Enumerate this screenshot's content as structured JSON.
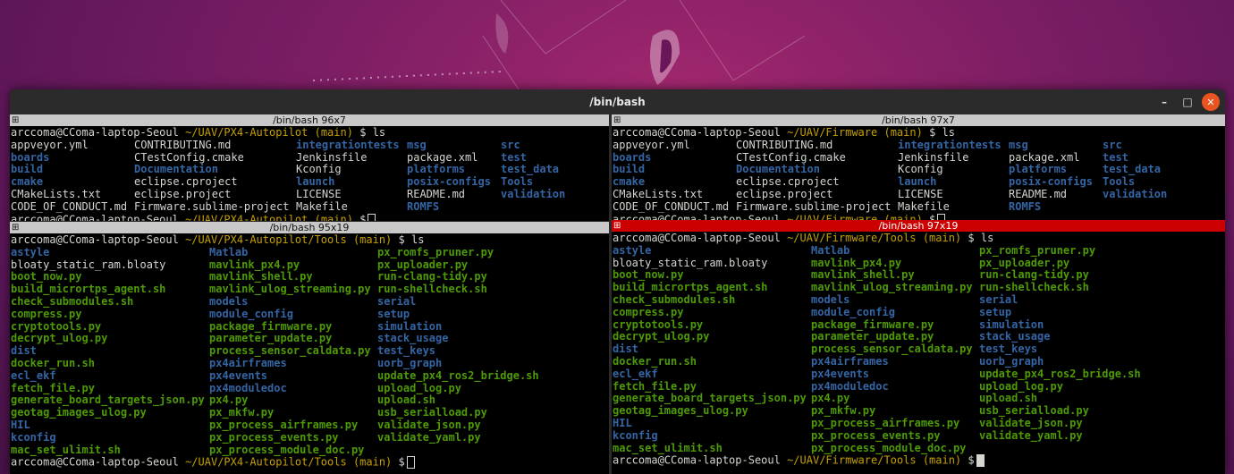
{
  "window": {
    "title": "/bin/bash",
    "controls": {
      "minimize": "–",
      "maximize": "□",
      "close": "✕"
    }
  },
  "colors": {
    "dir": "#3465a4",
    "exec": "#4e9a06",
    "file": "#d3d7cf",
    "branch": "#c4a000",
    "active_title": "#cc0000"
  },
  "icons": {
    "pane": "split-pane-icon"
  },
  "panes": [
    {
      "title": "/bin/bash 96x7",
      "active": false,
      "prompt_user": "arccoma@CComa-laptop-Seoul",
      "prompt_path": "~/UAV/PX4-Autopilot",
      "prompt_branch": "(main)",
      "command": "$ ls",
      "columns": [
        [
          {
            "t": "appveyor.yml",
            "k": "f"
          },
          {
            "t": "boards",
            "k": "d"
          },
          {
            "t": "build",
            "k": "d"
          },
          {
            "t": "cmake",
            "k": "d"
          },
          {
            "t": "CMakeLists.txt",
            "k": "f"
          },
          {
            "t": "CODE_OF_CONDUCT.md",
            "k": "f"
          }
        ],
        [
          {
            "t": "CONTRIBUTING.md",
            "k": "f"
          },
          {
            "t": "CTestConfig.cmake",
            "k": "f"
          },
          {
            "t": "Documentation",
            "k": "d"
          },
          {
            "t": "eclipse.cproject",
            "k": "f"
          },
          {
            "t": "eclipse.project",
            "k": "f"
          },
          {
            "t": "Firmware.sublime-project",
            "k": "f"
          }
        ],
        [
          {
            "t": "integrationtests",
            "k": "d"
          },
          {
            "t": "Jenkinsfile",
            "k": "f"
          },
          {
            "t": "Kconfig",
            "k": "f"
          },
          {
            "t": "launch",
            "k": "d"
          },
          {
            "t": "LICENSE",
            "k": "f"
          },
          {
            "t": "Makefile",
            "k": "f"
          }
        ],
        [
          {
            "t": "msg",
            "k": "d"
          },
          {
            "t": "package.xml",
            "k": "f"
          },
          {
            "t": "platforms",
            "k": "d"
          },
          {
            "t": "posix-configs",
            "k": "d"
          },
          {
            "t": "README.md",
            "k": "f"
          },
          {
            "t": "ROMFS",
            "k": "d"
          }
        ],
        [
          {
            "t": "src",
            "k": "d"
          },
          {
            "t": "test",
            "k": "d"
          },
          {
            "t": "test_data",
            "k": "d"
          },
          {
            "t": "Tools",
            "k": "d"
          },
          {
            "t": "validation",
            "k": "d"
          }
        ]
      ],
      "trailing_prompt": true
    },
    {
      "title": "/bin/bash 97x7",
      "active": false,
      "prompt_user": "arccoma@CComa-laptop-Seoul",
      "prompt_path": "~/UAV/Firmware",
      "prompt_branch": "(main)",
      "command": "$ ls",
      "columns": [
        [
          {
            "t": "appveyor.yml",
            "k": "f"
          },
          {
            "t": "boards",
            "k": "d"
          },
          {
            "t": "build",
            "k": "d"
          },
          {
            "t": "cmake",
            "k": "d"
          },
          {
            "t": "CMakeLists.txt",
            "k": "f"
          },
          {
            "t": "CODE_OF_CONDUCT.md",
            "k": "f"
          }
        ],
        [
          {
            "t": "CONTRIBUTING.md",
            "k": "f"
          },
          {
            "t": "CTestConfig.cmake",
            "k": "f"
          },
          {
            "t": "Documentation",
            "k": "d"
          },
          {
            "t": "eclipse.cproject",
            "k": "f"
          },
          {
            "t": "eclipse.project",
            "k": "f"
          },
          {
            "t": "Firmware.sublime-project",
            "k": "f"
          }
        ],
        [
          {
            "t": "integrationtests",
            "k": "d"
          },
          {
            "t": "Jenkinsfile",
            "k": "f"
          },
          {
            "t": "Kconfig",
            "k": "f"
          },
          {
            "t": "launch",
            "k": "d"
          },
          {
            "t": "LICENSE",
            "k": "f"
          },
          {
            "t": "Makefile",
            "k": "f"
          }
        ],
        [
          {
            "t": "msg",
            "k": "d"
          },
          {
            "t": "package.xml",
            "k": "f"
          },
          {
            "t": "platforms",
            "k": "d"
          },
          {
            "t": "posix-configs",
            "k": "d"
          },
          {
            "t": "README.md",
            "k": "f"
          },
          {
            "t": "ROMFS",
            "k": "d"
          }
        ],
        [
          {
            "t": "src",
            "k": "d"
          },
          {
            "t": "test",
            "k": "d"
          },
          {
            "t": "test_data",
            "k": "d"
          },
          {
            "t": "Tools",
            "k": "d"
          },
          {
            "t": "validation",
            "k": "d"
          }
        ]
      ],
      "trailing_prompt": true
    },
    {
      "title": "/bin/bash 95x19",
      "active": false,
      "prompt_user": "arccoma@CComa-laptop-Seoul",
      "prompt_path": "~/UAV/PX4-Autopilot/Tools",
      "prompt_branch": "(main)",
      "command": "$ ls",
      "columns": [
        [
          {
            "t": "astyle",
            "k": "d"
          },
          {
            "t": "bloaty_static_ram.bloaty",
            "k": "f"
          },
          {
            "t": "boot_now.py",
            "k": "x"
          },
          {
            "t": "build_micrortps_agent.sh",
            "k": "x"
          },
          {
            "t": "check_submodules.sh",
            "k": "x"
          },
          {
            "t": "compress.py",
            "k": "x"
          },
          {
            "t": "cryptotools.py",
            "k": "x"
          },
          {
            "t": "decrypt_ulog.py",
            "k": "x"
          },
          {
            "t": "dist",
            "k": "d"
          },
          {
            "t": "docker_run.sh",
            "k": "x"
          },
          {
            "t": "ecl_ekf",
            "k": "d"
          },
          {
            "t": "fetch_file.py",
            "k": "x"
          },
          {
            "t": "generate_board_targets_json.py",
            "k": "x"
          },
          {
            "t": "geotag_images_ulog.py",
            "k": "x"
          },
          {
            "t": "HIL",
            "k": "d"
          },
          {
            "t": "kconfig",
            "k": "d"
          },
          {
            "t": "mac_set_ulimit.sh",
            "k": "x"
          }
        ],
        [
          {
            "t": "Matlab",
            "k": "d"
          },
          {
            "t": "mavlink_px4.py",
            "k": "x"
          },
          {
            "t": "mavlink_shell.py",
            "k": "x"
          },
          {
            "t": "mavlink_ulog_streaming.py",
            "k": "x"
          },
          {
            "t": "models",
            "k": "d"
          },
          {
            "t": "module_config",
            "k": "d"
          },
          {
            "t": "package_firmware.py",
            "k": "x"
          },
          {
            "t": "parameter_update.py",
            "k": "x"
          },
          {
            "t": "process_sensor_caldata.py",
            "k": "x"
          },
          {
            "t": "px4airframes",
            "k": "d"
          },
          {
            "t": "px4events",
            "k": "d"
          },
          {
            "t": "px4moduledoc",
            "k": "d"
          },
          {
            "t": "px4.py",
            "k": "x"
          },
          {
            "t": "px_mkfw.py",
            "k": "x"
          },
          {
            "t": "px_process_airframes.py",
            "k": "x"
          },
          {
            "t": "px_process_events.py",
            "k": "x"
          },
          {
            "t": "px_process_module_doc.py",
            "k": "x"
          }
        ],
        [
          {
            "t": "px_romfs_pruner.py",
            "k": "x"
          },
          {
            "t": "px_uploader.py",
            "k": "x"
          },
          {
            "t": "run-clang-tidy.py",
            "k": "x"
          },
          {
            "t": "run-shellcheck.sh",
            "k": "x"
          },
          {
            "t": "serial",
            "k": "d"
          },
          {
            "t": "setup",
            "k": "d"
          },
          {
            "t": "simulation",
            "k": "d"
          },
          {
            "t": "stack_usage",
            "k": "d"
          },
          {
            "t": "test_keys",
            "k": "d"
          },
          {
            "t": "uorb_graph",
            "k": "d"
          },
          {
            "t": "update_px4_ros2_bridge.sh",
            "k": "x"
          },
          {
            "t": "upload_log.py",
            "k": "x"
          },
          {
            "t": "upload.sh",
            "k": "x"
          },
          {
            "t": "usb_serialload.py",
            "k": "x"
          },
          {
            "t": "validate_json.py",
            "k": "x"
          },
          {
            "t": "validate_yaml.py",
            "k": "x"
          }
        ]
      ],
      "trailing_prompt": true
    },
    {
      "title": "/bin/bash 97x19",
      "active": true,
      "prompt_user": "arccoma@CComa-laptop-Seoul",
      "prompt_path": "~/UAV/Firmware/Tools",
      "prompt_branch": "(main)",
      "command": "$ ls",
      "columns": [
        [
          {
            "t": "astyle",
            "k": "d"
          },
          {
            "t": "bloaty_static_ram.bloaty",
            "k": "f"
          },
          {
            "t": "boot_now.py",
            "k": "x"
          },
          {
            "t": "build_micrortps_agent.sh",
            "k": "x"
          },
          {
            "t": "check_submodules.sh",
            "k": "x"
          },
          {
            "t": "compress.py",
            "k": "x"
          },
          {
            "t": "cryptotools.py",
            "k": "x"
          },
          {
            "t": "decrypt_ulog.py",
            "k": "x"
          },
          {
            "t": "dist",
            "k": "d"
          },
          {
            "t": "docker_run.sh",
            "k": "x"
          },
          {
            "t": "ecl_ekf",
            "k": "d"
          },
          {
            "t": "fetch_file.py",
            "k": "x"
          },
          {
            "t": "generate_board_targets_json.py",
            "k": "x"
          },
          {
            "t": "geotag_images_ulog.py",
            "k": "x"
          },
          {
            "t": "HIL",
            "k": "d"
          },
          {
            "t": "kconfig",
            "k": "d"
          },
          {
            "t": "mac_set_ulimit.sh",
            "k": "x"
          }
        ],
        [
          {
            "t": "Matlab",
            "k": "d"
          },
          {
            "t": "mavlink_px4.py",
            "k": "x"
          },
          {
            "t": "mavlink_shell.py",
            "k": "x"
          },
          {
            "t": "mavlink_ulog_streaming.py",
            "k": "x"
          },
          {
            "t": "models",
            "k": "d"
          },
          {
            "t": "module_config",
            "k": "d"
          },
          {
            "t": "package_firmware.py",
            "k": "x"
          },
          {
            "t": "parameter_update.py",
            "k": "x"
          },
          {
            "t": "process_sensor_caldata.py",
            "k": "x"
          },
          {
            "t": "px4airframes",
            "k": "d"
          },
          {
            "t": "px4events",
            "k": "d"
          },
          {
            "t": "px4moduledoc",
            "k": "d"
          },
          {
            "t": "px4.py",
            "k": "x"
          },
          {
            "t": "px_mkfw.py",
            "k": "x"
          },
          {
            "t": "px_process_airframes.py",
            "k": "x"
          },
          {
            "t": "px_process_events.py",
            "k": "x"
          },
          {
            "t": "px_process_module_doc.py",
            "k": "x"
          }
        ],
        [
          {
            "t": "px_romfs_pruner.py",
            "k": "x"
          },
          {
            "t": "px_uploader.py",
            "k": "x"
          },
          {
            "t": "run-clang-tidy.py",
            "k": "x"
          },
          {
            "t": "run-shellcheck.sh",
            "k": "x"
          },
          {
            "t": "serial",
            "k": "d"
          },
          {
            "t": "setup",
            "k": "d"
          },
          {
            "t": "simulation",
            "k": "d"
          },
          {
            "t": "stack_usage",
            "k": "d"
          },
          {
            "t": "test_keys",
            "k": "d"
          },
          {
            "t": "uorb_graph",
            "k": "d"
          },
          {
            "t": "update_px4_ros2_bridge.sh",
            "k": "x"
          },
          {
            "t": "upload_log.py",
            "k": "x"
          },
          {
            "t": "upload.sh",
            "k": "x"
          },
          {
            "t": "usb_serialload.py",
            "k": "x"
          },
          {
            "t": "validate_json.py",
            "k": "x"
          },
          {
            "t": "validate_yaml.py",
            "k": "x"
          }
        ]
      ],
      "trailing_prompt": true
    }
  ]
}
